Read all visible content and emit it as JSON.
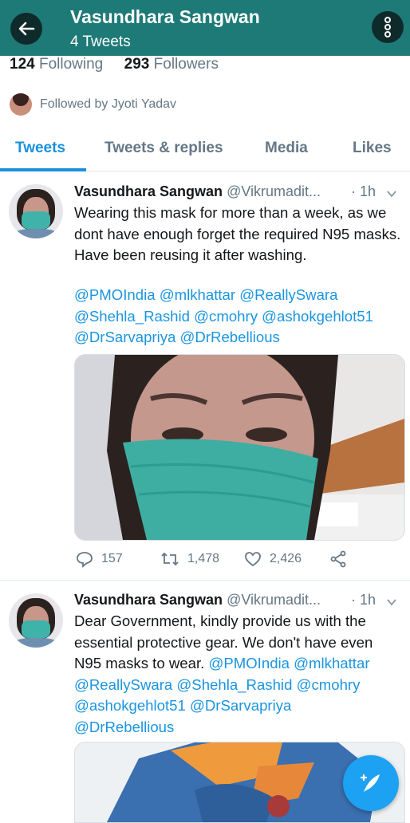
{
  "header": {
    "name": "Vasundhara Sangwan",
    "tweet_count": "4 Tweets"
  },
  "profile": {
    "following_count": "124",
    "following_label": "Following",
    "followers_count": "293",
    "followers_label": "Followers",
    "followed_by": "Followed by Jyoti Yadav"
  },
  "tabs": [
    {
      "label": "Tweets",
      "active": true
    },
    {
      "label": "Tweets & replies"
    },
    {
      "label": "Media"
    },
    {
      "label": "Likes"
    }
  ],
  "tweets": [
    {
      "name": "Vasundhara Sangwan",
      "handle": "@Vikrumadit...",
      "time": "· 1h",
      "text": "Wearing this mask for more than a week, as we dont have enough forget the required N95 masks. Have been reusing it after washing.",
      "mentions_line1": "@PMOIndia @mlkhattar @ReallySwara",
      "mentions_line2": "@Shehla_Rashid @cmohry @ashokgehlot51",
      "mentions_line3": "@DrSarvapriya @DrRebellious",
      "replies": "157",
      "retweets": "1,478",
      "likes": "2,426"
    },
    {
      "name": "Vasundhara Sangwan",
      "handle": "@Vikrumadit...",
      "time": "· 1h",
      "text_line1": "Dear Government, kindly provide us with the",
      "text_line2": "essential protective gear. We don't have even",
      "text_line3": "N95 masks to wear.",
      "mention_a": "@PMOIndia @mlkhattar",
      "mention_b": "@ReallySwara @Shehla_Rashid @cmohry",
      "mention_c": "@ashokgehlot51 @DrSarvapriya",
      "mention_d": "@DrRebellious"
    }
  ],
  "colors": {
    "header_bg": "#1e7a77",
    "accent": "#1da1f2",
    "mention": "#1b95e0"
  }
}
